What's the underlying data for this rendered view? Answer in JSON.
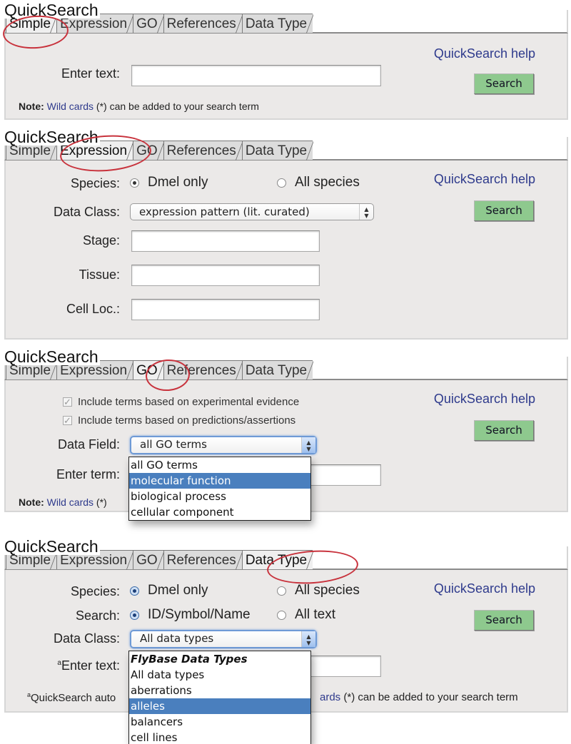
{
  "common": {
    "title": "QuickSearch",
    "tabs": [
      "Simple",
      "Expression",
      "GO",
      "References",
      "Data Type"
    ],
    "help_link": "QuickSearch help",
    "search_button": "Search",
    "note_bold": "Note:",
    "note_link": "Wild cards",
    "note_rest": "(*) can be added to your search term"
  },
  "panels": {
    "simple": {
      "active_tab": "Simple",
      "enter_text_label": "Enter text:",
      "enter_text_value": ""
    },
    "expression": {
      "active_tab": "Expression",
      "species_label": "Species:",
      "species_options": [
        "Dmel only",
        "All species"
      ],
      "species_selected": "Dmel only",
      "data_class_label": "Data Class:",
      "data_class_value": "expression pattern (lit. curated)",
      "stage_label": "Stage:",
      "tissue_label": "Tissue:",
      "cell_loc_label": "Cell Loc.:"
    },
    "go": {
      "active_tab": "GO",
      "checkbox_experimental": "Include terms based on experimental evidence",
      "checkbox_predictions": "Include terms based on predictions/assertions",
      "data_field_label": "Data Field:",
      "data_field_value": "all GO terms",
      "enter_term_label": "Enter term:",
      "dropdown_options": [
        "all GO terms",
        "molecular function",
        "biological process",
        "cellular component"
      ],
      "dropdown_highlighted": "molecular function",
      "note_truncated": "(*)"
    },
    "datatype": {
      "active_tab": "Data Type",
      "species_label": "Species:",
      "species_options": [
        "Dmel only",
        "All species"
      ],
      "species_selected": "Dmel only",
      "search_label": "Search:",
      "search_options": [
        "ID/Symbol/Name",
        "All text"
      ],
      "search_selected": "ID/Symbol/Name",
      "data_class_label": "Data Class:",
      "data_class_value": "All data types",
      "enter_text_label": "Enter text:",
      "footnote_marker": "a",
      "footnote_start": "QuickSearch auto",
      "footnote_link_tail": "ards",
      "dropdown_group": "FlyBase Data Types",
      "dropdown_options": [
        "All data types",
        "aberrations",
        "alleles",
        "balancers",
        "cell lines"
      ],
      "dropdown_highlighted": "alleles"
    }
  }
}
